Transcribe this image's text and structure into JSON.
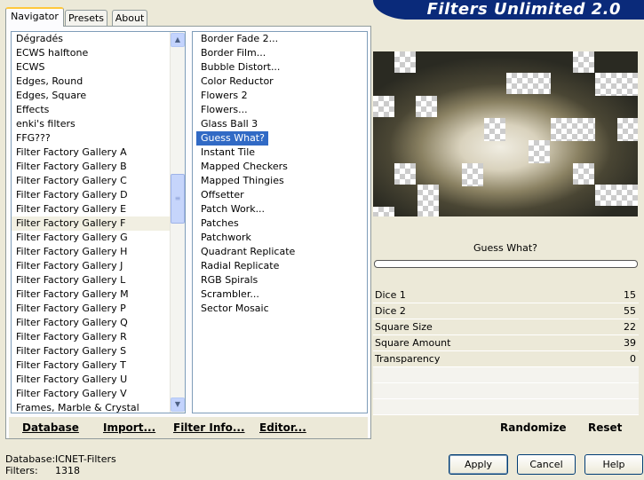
{
  "header": {
    "title": "Filters Unlimited 2.0"
  },
  "tabs": [
    {
      "label": "Navigator",
      "active": true
    },
    {
      "label": "Presets",
      "active": false
    },
    {
      "label": "About",
      "active": false
    }
  ],
  "categories": {
    "selected": "Filter Factory Gallery F",
    "items": [
      "Dégradés",
      "ECWS halftone",
      "ECWS",
      "Edges, Round",
      "Edges, Square",
      "Effects",
      "enki's filters",
      "FFG???",
      "Filter Factory Gallery A",
      "Filter Factory Gallery B",
      "Filter Factory Gallery C",
      "Filter Factory Gallery D",
      "Filter Factory Gallery E",
      "Filter Factory Gallery F",
      "Filter Factory Gallery G",
      "Filter Factory Gallery H",
      "Filter Factory Gallery J",
      "Filter Factory Gallery L",
      "Filter Factory Gallery M",
      "Filter Factory Gallery P",
      "Filter Factory Gallery Q",
      "Filter Factory Gallery R",
      "Filter Factory Gallery S",
      "Filter Factory Gallery T",
      "Filter Factory Gallery U",
      "Filter Factory Gallery V",
      "Frames, Marble & Crystal"
    ]
  },
  "filters": {
    "selected": "Guess What?",
    "items": [
      "Border Fade 2...",
      "Border Film...",
      "Bubble Distort...",
      "Color Reductor",
      "Flowers 2",
      "Flowers...",
      "Glass Ball 3",
      "Guess What?",
      "Instant Tile",
      "Mapped Checkers",
      "Mapped Thingies",
      "Offsetter",
      "Patch Work...",
      "Patches",
      "Patchwork",
      "Quadrant Replicate",
      "Radial Replicate",
      "RGB Spirals",
      "Scrambler...",
      "Sector Mosaic"
    ]
  },
  "left_bar": {
    "database": "Database",
    "import": "Import...",
    "filter_info": "Filter Info...",
    "editor": "Editor..."
  },
  "preview": {
    "label": "Guess What?",
    "progress": 0
  },
  "params": [
    {
      "name": "Dice 1",
      "value": "15"
    },
    {
      "name": "Dice 2",
      "value": "55"
    },
    {
      "name": "Square Size",
      "value": "22"
    },
    {
      "name": "Square Amount",
      "value": "39"
    },
    {
      "name": "Transparency",
      "value": "0"
    }
  ],
  "right_bar": {
    "randomize": "Randomize",
    "reset": "Reset"
  },
  "status": {
    "database_label": "Database:",
    "database_value": "ICNET-Filters",
    "filters_label": "Filters:",
    "filters_value": "1318"
  },
  "buttons": {
    "apply": "Apply",
    "cancel": "Cancel",
    "help": "Help"
  },
  "colors": {
    "banner": "#0a2a7a",
    "selection": "#316ac5",
    "window": "#ece9d8"
  }
}
